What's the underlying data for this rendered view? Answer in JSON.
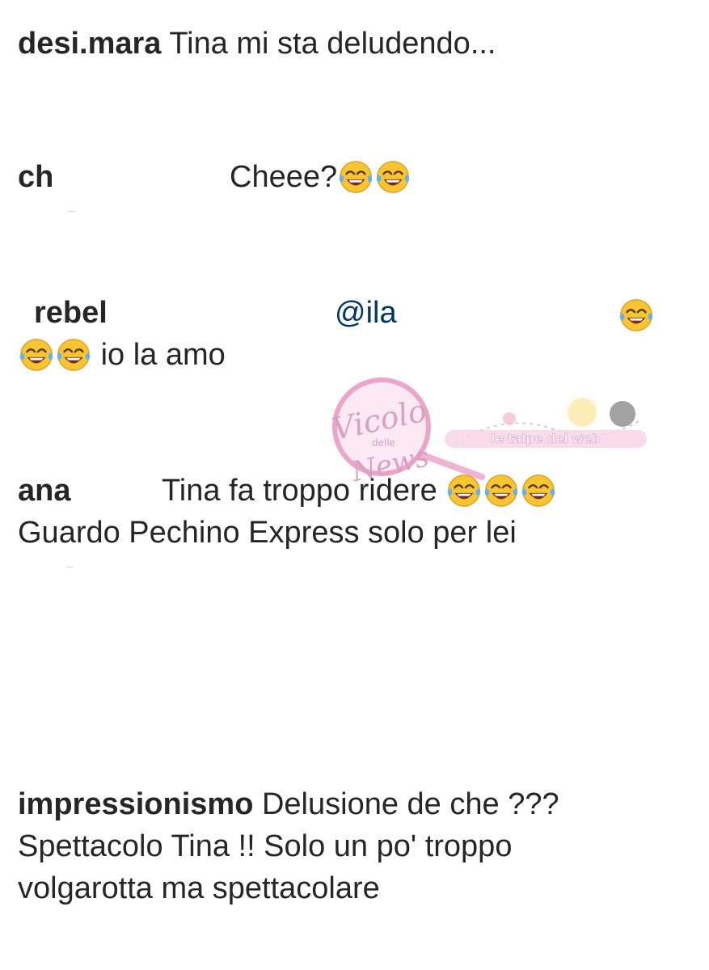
{
  "comments": [
    {
      "user": "desi.mara",
      "text": "Tina mi sta deludendo..."
    },
    {
      "user": "ch",
      "text": "Cheee?"
    },
    {
      "user": "rebel",
      "mention": "@ila",
      "text": "io la amo"
    },
    {
      "user": "ana",
      "line1": "Tina fa troppo ridere",
      "line2": "Guardo Pechino Express solo per lei"
    },
    {
      "user": "impressionismo",
      "line1": "Delusione de che ???",
      "line2": "Spettacolo Tina !! Solo un po' troppo",
      "line3": "volgarotta ma spettacolare"
    }
  ],
  "emoji": {
    "name": "face-with-tears-of-joy-icon",
    "color": "#f4b400"
  },
  "watermark": {
    "logo_word1": "Vicolo",
    "logo_word2": "delle",
    "logo_word3": "News",
    "banner": "le talpe del web",
    "accent": "#e060a0"
  }
}
